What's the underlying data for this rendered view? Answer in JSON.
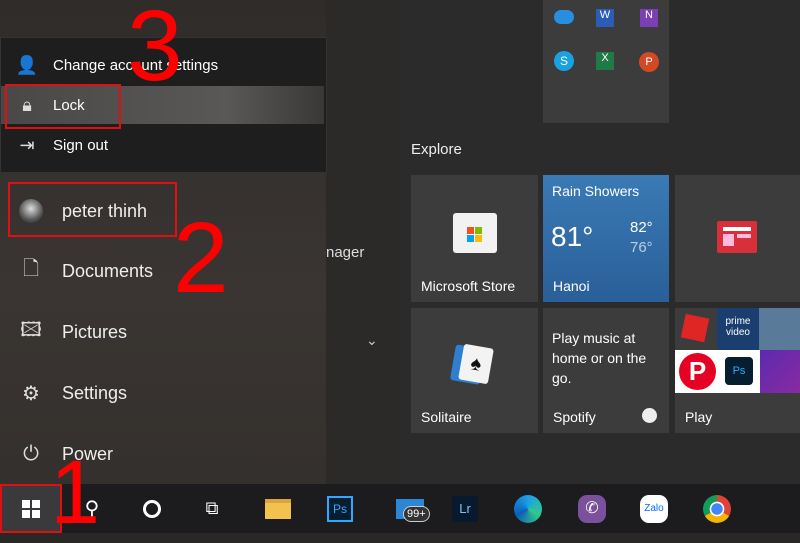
{
  "flyout": {
    "items": [
      {
        "label": "Change account settings",
        "icon": "account-settings-icon"
      },
      {
        "label": "Lock",
        "icon": "lock-icon"
      },
      {
        "label": "Sign out",
        "icon": "sign-out-icon"
      }
    ]
  },
  "user": {
    "name": "peter thinh"
  },
  "left_items": [
    {
      "label": "Documents",
      "icon": "document-icon"
    },
    {
      "label": "Pictures",
      "icon": "pictures-icon"
    },
    {
      "label": "Settings",
      "icon": "gear-icon"
    },
    {
      "label": "Power",
      "icon": "power-icon"
    }
  ],
  "middle": {
    "partial_text": "nager"
  },
  "tiles": {
    "group_label": "Explore",
    "store": {
      "label": "Microsoft Store"
    },
    "weather": {
      "condition": "Rain Showers",
      "temp": "81°",
      "high": "82°",
      "low": "76°",
      "city": "Hanoi",
      "color": "#2f6aa3"
    },
    "news": {
      "label": ""
    },
    "solitaire": {
      "label": "Solitaire"
    },
    "spotify": {
      "text": "Play music at home or on the go.",
      "label": "Spotify"
    },
    "play": {
      "label": "Play",
      "prime": "prime video"
    }
  },
  "taskbar": {
    "mail_badge": "99+",
    "icons": [
      "start-icon",
      "search-icon",
      "cortana-icon",
      "task-view-icon",
      "file-explorer-icon",
      "photoshop-icon",
      "mail-icon",
      "lightroom-icon",
      "edge-icon",
      "viber-icon",
      "zalo-icon",
      "chrome-icon"
    ],
    "ps": "Ps",
    "lr": "Lr",
    "zalo": "Zalo"
  },
  "annotations": {
    "step1": "1",
    "step2": "2",
    "step3": "3",
    "color": "#e01010"
  }
}
